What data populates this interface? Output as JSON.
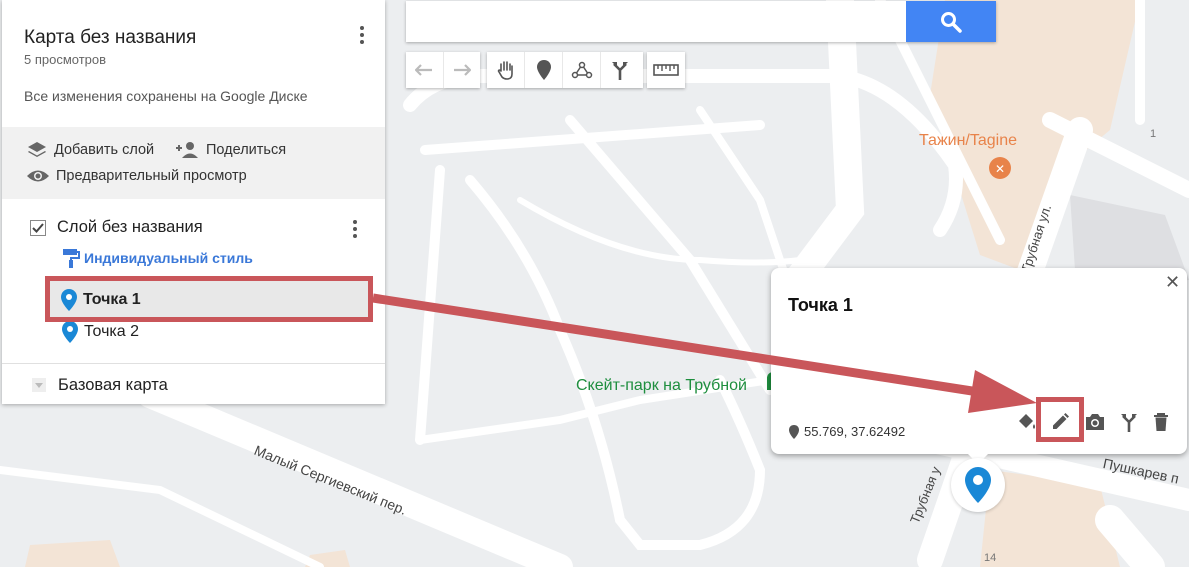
{
  "map": {
    "poi_restaurant": "Тажин/Tagine",
    "poi_park": "Скейт-парк на Трубной",
    "street_trubnaya": "Трубная ул.",
    "street_trubnaya_lower": "Трубная у",
    "street_malyi_sergievskiy": "Малый Сергиевский пер.",
    "street_pushkarev": "Пушкарев п",
    "house_1": "1",
    "house_14": "14",
    "park_color": "#1e8e3e",
    "restaurant_color": "#e8834a"
  },
  "panel": {
    "map_title": "Карта без названия",
    "views": "5 просмотров",
    "saved_status": "Все изменения сохранены на Google Диске",
    "actions": {
      "add_layer": "Добавить слой",
      "share": "Поделиться",
      "preview": "Предварительный просмотр"
    },
    "layer": {
      "name": "Слой без названия",
      "checked": true,
      "style_link": "Индивидуальный стиль",
      "points": [
        "Точка 1",
        "Точка 2"
      ],
      "selected_point": "Точка 1"
    },
    "base_map": "Базовая карта"
  },
  "search": {
    "value": "",
    "button_icon": "search-icon",
    "button_color": "#4285f4"
  },
  "toolbar": {
    "tools": [
      "undo-icon",
      "redo-icon",
      "hand-icon",
      "marker-icon",
      "draw-line-icon",
      "directions-icon",
      "ruler-icon"
    ]
  },
  "info_window": {
    "title": "Точка 1",
    "coords": "55.769, 37.62492",
    "actions": [
      "paint-bucket-icon",
      "pencil-icon",
      "camera-icon",
      "directions-icon",
      "trash-icon"
    ]
  },
  "annotation": {
    "color": "#c9565a"
  },
  "marker_color": "#1a88d6"
}
